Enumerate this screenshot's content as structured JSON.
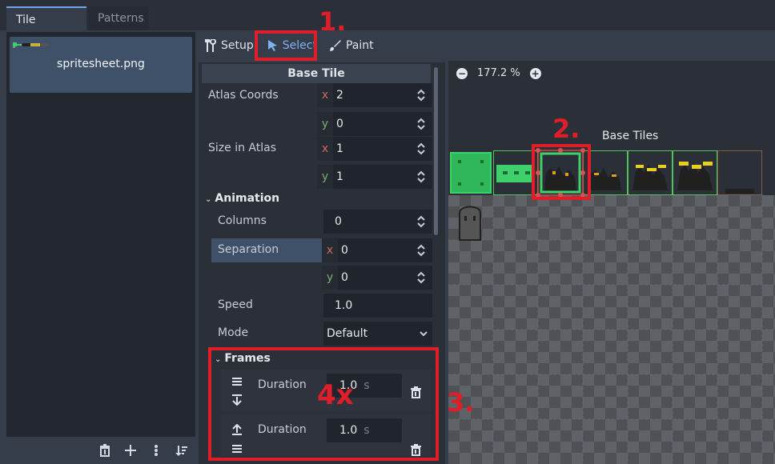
{
  "tabs": {
    "tile_sources": "Tile Sources",
    "patterns": "Patterns"
  },
  "sources": {
    "item_label": "spritesheet.png"
  },
  "modes": {
    "setup": "Setup",
    "select": "Select",
    "paint": "Paint"
  },
  "inspector": {
    "base_tile_title": "Base Tile",
    "atlas_coords_label": "Atlas Coords",
    "atlas_x": "2",
    "atlas_y": "0",
    "size_label": "Size in Atlas",
    "size_x": "1",
    "size_y": "1",
    "animation_label": "Animation",
    "columns_label": "Columns",
    "columns_value": "0",
    "separation_label": "Separation",
    "sep_x": "0",
    "sep_y": "0",
    "speed_label": "Speed",
    "speed_value": "1.0",
    "mode_label": "Mode",
    "mode_value": "Default",
    "frames_label": "Frames",
    "frames": [
      {
        "duration_label": "Duration",
        "value": "1.0",
        "unit": "s"
      },
      {
        "duration_label": "Duration",
        "value": "1.0",
        "unit": "s"
      }
    ],
    "axis_x": "x",
    "axis_y": "y"
  },
  "canvas": {
    "zoom": "177.2 %",
    "base_tiles_label": "Base Tiles"
  },
  "annotations": {
    "step1": "1.",
    "step2": "2.",
    "step3": "3.",
    "repeat": "4x"
  },
  "colors": {
    "accent": "#70a6e8",
    "annotation": "#e01e2a",
    "tile_green": "#3ed06a"
  }
}
